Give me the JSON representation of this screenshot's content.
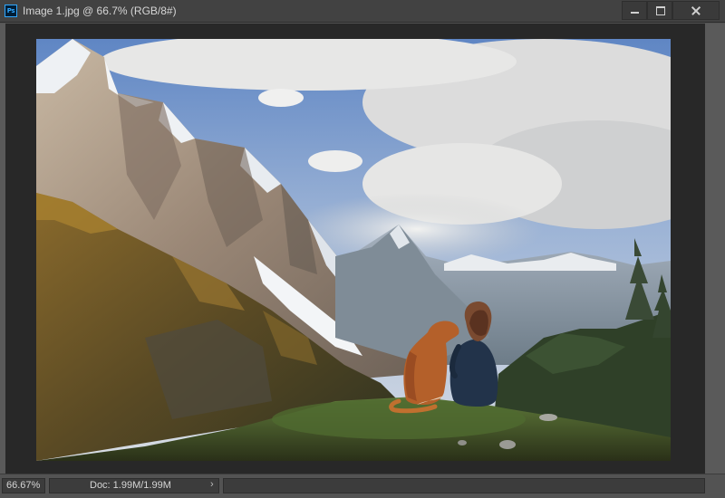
{
  "window": {
    "app_icon_label": "Ps",
    "title": "Image 1.jpg @ 66.7% (RGB/8#)",
    "controls": {
      "minimize_icon": "minimize-icon",
      "maximize_icon": "maximize-icon",
      "close_icon": "close-icon"
    }
  },
  "canvas": {
    "image_subject": "photo-mountains-woman-dog"
  },
  "statusbar": {
    "zoom_value": "66.67%",
    "doc_info": "Doc: 1.99M/1.99M",
    "expand_glyph": "›"
  },
  "colors": {
    "titlebar_bg": "#424242",
    "canvas_bg": "#282828",
    "panel_bg": "#535353",
    "accent_ps": "#31a8ff"
  }
}
